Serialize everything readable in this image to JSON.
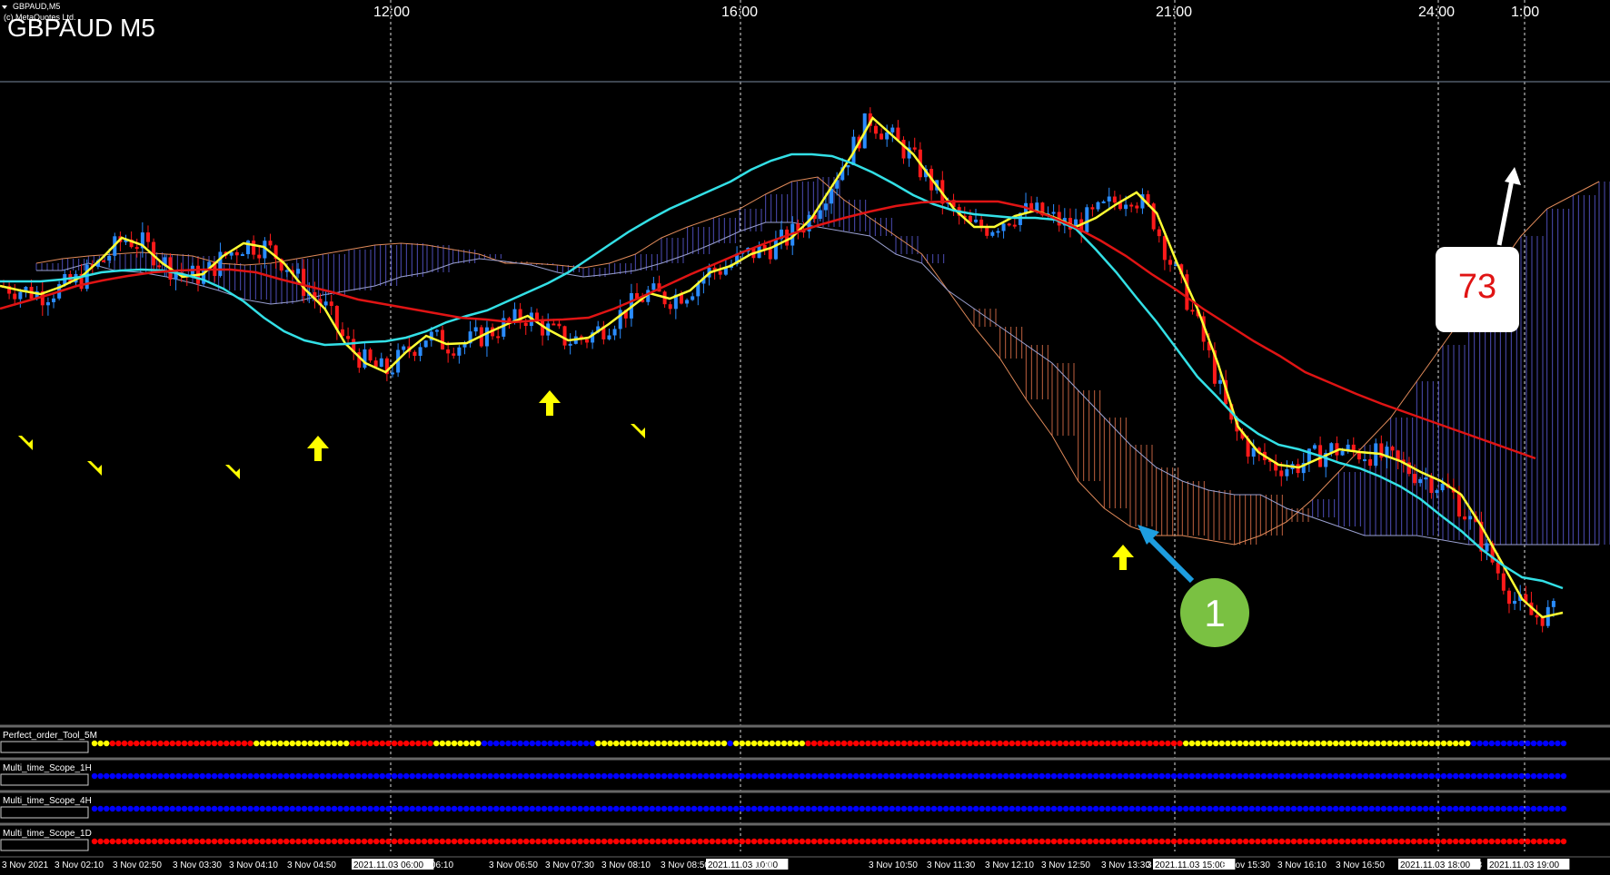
{
  "window": {
    "symbol_small": "GBPAUD,M5",
    "copyright": "(c) MetaQuotes Ltd.",
    "title": "GBPAUD M5"
  },
  "hour_labels": [
    "12:00",
    "16:00",
    "21:00",
    "24:00",
    "1:00"
  ],
  "bottom_ticks": [
    {
      "text": "3 Nov 2021",
      "boxed": false
    },
    {
      "text": "3 Nov 02:10",
      "boxed": false
    },
    {
      "text": "3 Nov 02:50",
      "boxed": false
    },
    {
      "text": "3 Nov 03:30",
      "boxed": false
    },
    {
      "text": "3 Nov 04:10",
      "boxed": false
    },
    {
      "text": "3 Nov 04:50",
      "boxed": false
    },
    {
      "text": "2021.11.03 06:00",
      "boxed": true
    },
    {
      "text": "06:10",
      "boxed": false
    },
    {
      "text": "3 Nov 06:50",
      "boxed": false
    },
    {
      "text": "3 Nov 07:30",
      "boxed": false
    },
    {
      "text": "3 Nov 08:10",
      "boxed": false
    },
    {
      "text": "3 Nov 08:50",
      "boxed": false
    },
    {
      "text": "2021.11.03 10:00",
      "boxed": true
    },
    {
      "text": "10:10",
      "boxed": false
    },
    {
      "text": "3 Nov 10:50",
      "boxed": false
    },
    {
      "text": "3 Nov 11:30",
      "boxed": false
    },
    {
      "text": "3 Nov 12:10",
      "boxed": false
    },
    {
      "text": "3 Nov 12:50",
      "boxed": false
    },
    {
      "text": "3 Nov 13:30",
      "boxed": false
    },
    {
      "text": "3 Nov 14",
      "boxed": false
    },
    {
      "text": "2021.11.03 15:00",
      "boxed": true
    },
    {
      "text": "3 Nov 15:30",
      "boxed": false
    },
    {
      "text": "3 Nov 16:10",
      "boxed": false
    },
    {
      "text": "3 Nov 16:50",
      "boxed": false
    },
    {
      "text": "2021.11.03 18:00",
      "boxed": true
    },
    {
      "text": "18",
      "boxed": false
    },
    {
      "text": "2021.11.03 19:00",
      "boxed": true
    }
  ],
  "indicators": [
    {
      "name": "Perfect_order_Tool_5M",
      "runs": [
        [
          "yellow",
          3
        ],
        [
          "red",
          24
        ],
        [
          "yellow",
          16
        ],
        [
          "red",
          14
        ],
        [
          "yellow",
          8
        ],
        [
          "blue",
          19
        ],
        [
          "yellow",
          22
        ],
        [
          "blue",
          1
        ],
        [
          "yellow",
          12
        ],
        [
          "red",
          63
        ],
        [
          "yellow",
          48
        ],
        [
          "blue",
          93
        ],
        [
          "yellow",
          3
        ]
      ]
    },
    {
      "name": "Multi_time_Scope_1H",
      "runs": [
        [
          "blue",
          256
        ]
      ]
    },
    {
      "name": "Multi_time_Scope_4H",
      "runs": [
        [
          "blue",
          256
        ]
      ]
    },
    {
      "name": "Multi_time_Scope_1D",
      "runs": [
        [
          "red",
          256
        ]
      ]
    }
  ],
  "annotations": {
    "badge_1": "1",
    "label_73": "73"
  },
  "colors": {
    "background": "#000000",
    "bull_candle": "#2a8cff",
    "bear_candle": "#ff1a1a",
    "ma_fast": "#ffff33",
    "ma_mid": "#33e0e6",
    "ma_slow": "#e01414",
    "cloud_up": "#5c5cd6",
    "cloud_down": "#e0724a",
    "signal_arrow": "#ffff00",
    "badge_green": "#7ac142",
    "arrow_blue": "#1e9ee0",
    "dot_yellow": "#ffff00",
    "dot_red": "#ff0000",
    "dot_blue": "#0000ff"
  },
  "chart_data": {
    "type": "candlestick",
    "symbol": "GBPAUD",
    "timeframe": "M5",
    "series": [
      {
        "name": "",
        "color": "yellow",
        "values": [
          445,
          440,
          436,
          444,
          455,
          475,
          498,
          490,
          470,
          455,
          458,
          478,
          492,
          488,
          470,
          442,
          420,
          382,
          360,
          350,
          372,
          390,
          381,
          382,
          393,
          403,
          412,
          397,
          385,
          388,
          403,
          420,
          437,
          431,
          440,
          460,
          467,
          480,
          487,
          498,
          520,
          555,
          590,
          630,
          610,
          590,
          560,
          530,
          510,
          510,
          522,
          528,
          520,
          510,
          520,
          535,
          548,
          525,
          470,
          420,
          360,
          290,
          262,
          248,
          245,
          255,
          265,
          262,
          260,
          252,
          240,
          230,
          215,
          180,
          140,
          100,
          80,
          85
        ]
      },
      {
        "name": "",
        "color": "cyan",
        "values": [
          450,
          450,
          450,
          452,
          455,
          460,
          462,
          463,
          462,
          458,
          452,
          442,
          428,
          410,
          395,
          385,
          380,
          381,
          383,
          384,
          388,
          395,
          405,
          412,
          418,
          428,
          438,
          448,
          460,
          475,
          490,
          505,
          518,
          530,
          540,
          550,
          560,
          573,
          583,
          590,
          590,
          588,
          580,
          570,
          558,
          545,
          535,
          528,
          524,
          522,
          520,
          520,
          518,
          508,
          485,
          460,
          432,
          405,
          375,
          345,
          322,
          298,
          282,
          270,
          265,
          258,
          250,
          244,
          235,
          224,
          210,
          192,
          175,
          155,
          138,
          124,
          120,
          112
        ]
      },
      {
        "name": "",
        "color": "red",
        "values": [
          420,
          428,
          436,
          445,
          451,
          456,
          460,
          462,
          463,
          463,
          460,
          452,
          445,
          438,
          430,
          425,
          420,
          415,
          410,
          408,
          405,
          407,
          408,
          410,
          420,
          432,
          445,
          458,
          470,
          482,
          493,
          503,
          512,
          520,
          527,
          533,
          537,
          538,
          538,
          538,
          532,
          522,
          510,
          495,
          478,
          458,
          440,
          420,
          402,
          384,
          368,
          350,
          338,
          326,
          315,
          305,
          295,
          285,
          275,
          265,
          255
        ]
      }
    ]
  }
}
